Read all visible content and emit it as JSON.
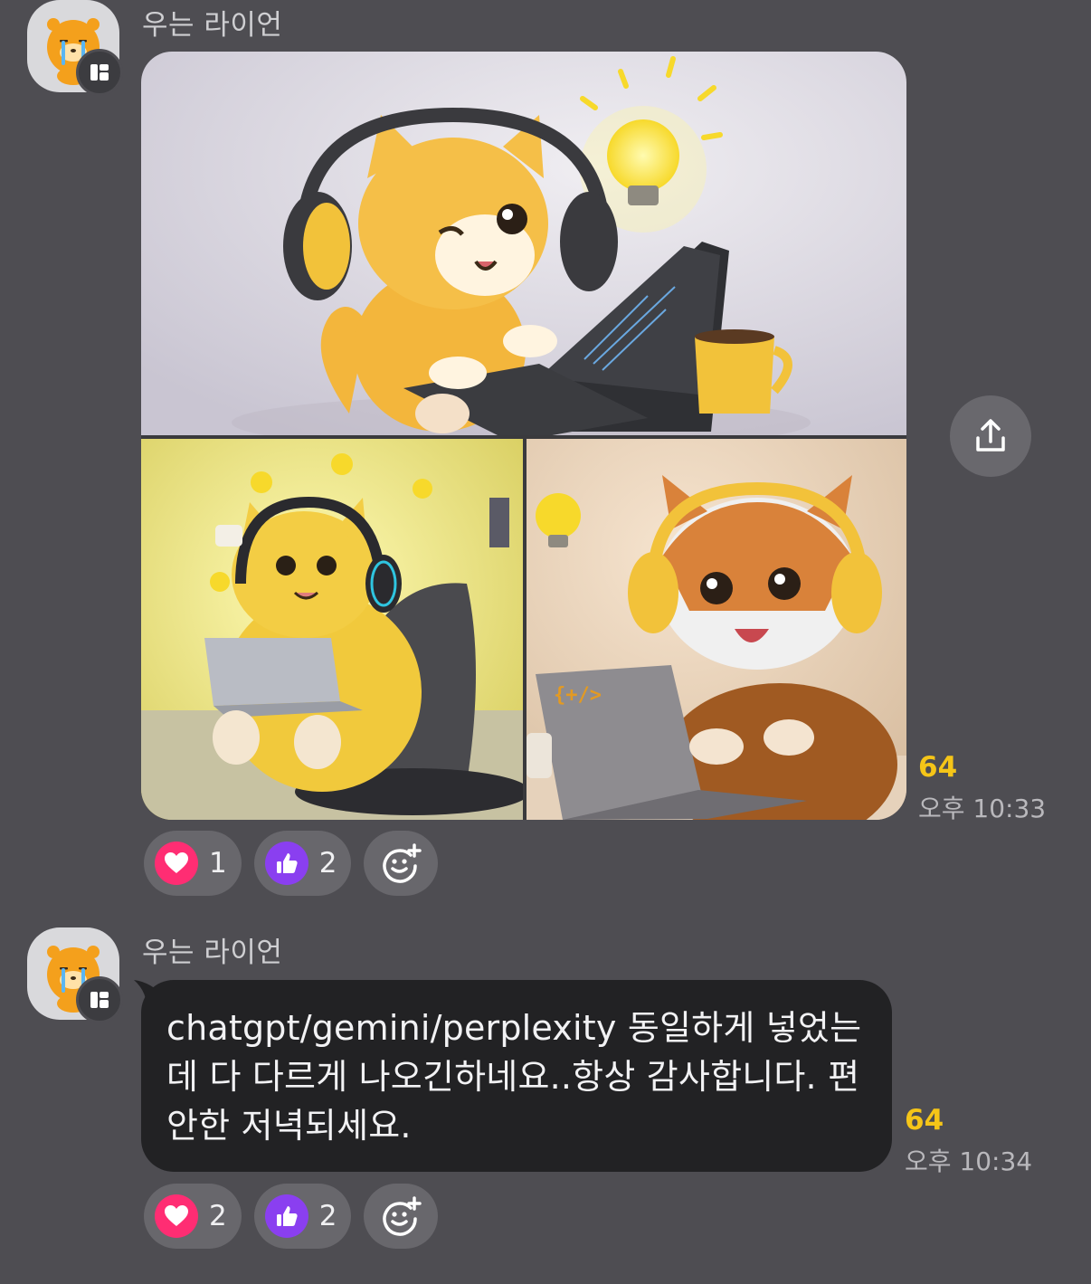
{
  "messages": [
    {
      "sender": "우는 라이언",
      "type": "image_grid",
      "images": [
        "cat-headphones-laptop-image",
        "cat-gaming-chair-image",
        "cat-sweater-laptop-image"
      ],
      "read_count": "64",
      "time": "오후 10:33",
      "reactions": [
        {
          "icon": "heart-icon",
          "count": "1",
          "color": "#ff2d73"
        },
        {
          "icon": "thumbs-up-icon",
          "count": "2",
          "color": "#8a3ff0"
        }
      ]
    },
    {
      "sender": "우는 라이언",
      "type": "text",
      "text": "chatgpt/gemini/perplexity 동일하게 넣었는데 다 다르게 나오긴하네요..항상 감사합니다. 편안한 저녁되세요.",
      "read_count": "64",
      "time": "오후 10:34",
      "reactions": [
        {
          "icon": "heart-icon",
          "count": "2",
          "color": "#ff2d73"
        },
        {
          "icon": "thumbs-up-icon",
          "count": "2",
          "color": "#8a3ff0"
        }
      ]
    }
  ],
  "colors": {
    "background": "#4e4d52",
    "bubble": "#222224",
    "read_count": "#f5c518"
  }
}
